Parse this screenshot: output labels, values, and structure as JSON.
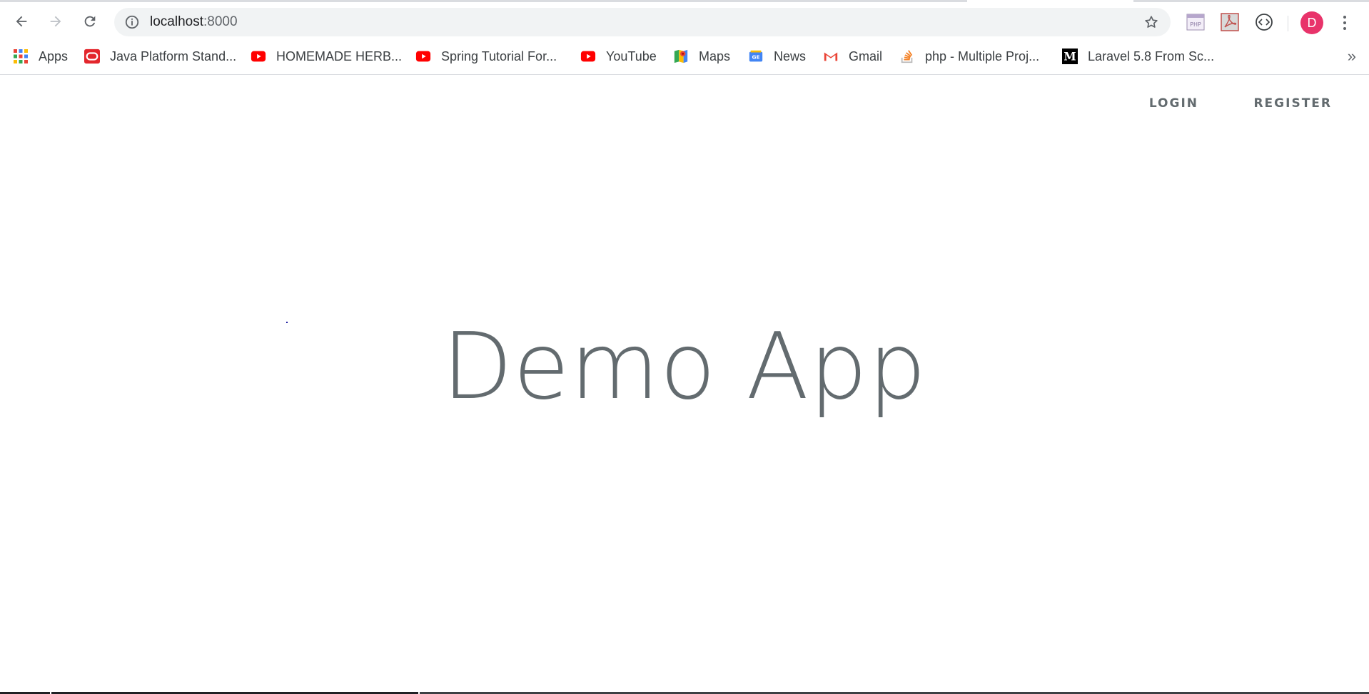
{
  "browser": {
    "address_host": "localhost",
    "address_port": ":8000",
    "avatar_initial": "D",
    "avatar_color": "#e8336a",
    "more_bookmarks": "»"
  },
  "bookmarks": [
    {
      "label": "Apps",
      "icon": "apps-grid-icon"
    },
    {
      "label": "Java Platform Stand...",
      "icon": "oracle-icon"
    },
    {
      "label": "HOMEMADE HERB...",
      "icon": "youtube-icon"
    },
    {
      "label": "Spring Tutorial For...",
      "icon": "youtube-icon"
    },
    {
      "label": "YouTube",
      "icon": "youtube-icon"
    },
    {
      "label": "Maps",
      "icon": "maps-icon"
    },
    {
      "label": "News",
      "icon": "news-icon"
    },
    {
      "label": "Gmail",
      "icon": "gmail-icon"
    },
    {
      "label": "php - Multiple Proj...",
      "icon": "stackoverflow-icon"
    },
    {
      "label": "Laravel 5.8 From Sc...",
      "icon": "medium-icon"
    }
  ],
  "page": {
    "login_label": "LOGIN",
    "register_label": "REGISTER",
    "title": "Demo App"
  }
}
